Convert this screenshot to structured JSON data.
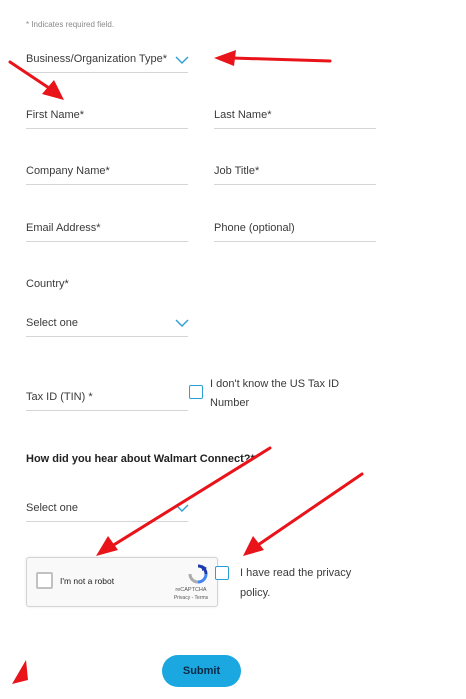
{
  "form": {
    "required_note": "* Indicates required field.",
    "business_type_label": "Business/Organization Type*",
    "first_name_label": "First Name*",
    "last_name_label": "Last Name*",
    "company_name_label": "Company Name*",
    "job_title_label": "Job Title*",
    "email_label": "Email Address*",
    "phone_label": "Phone (optional)",
    "country_label": "Country*",
    "country_select_value": "Select one",
    "tax_id_label": "Tax ID (TIN) *",
    "tax_id_unknown_line1": "I don't know the US Tax ID",
    "tax_id_unknown_line2": "Number",
    "hear_about_label": "How did you hear about Walmart Connect?*",
    "hear_about_select_value": "Select one",
    "privacy_line1": "I have read the privacy",
    "privacy_line2": "policy.",
    "submit_label": "Submit"
  },
  "recaptcha": {
    "label": "I'm not a robot",
    "brand": "reCAPTCHA",
    "links": "Privacy - Terms"
  },
  "colors": {
    "accent": "#1ba7e0",
    "chevron": "#2a9fd6",
    "annotation_arrow": "#e8141a"
  },
  "icons": {
    "dropdown": "chevron-down-icon",
    "captcha": "recaptcha-logo-icon"
  }
}
